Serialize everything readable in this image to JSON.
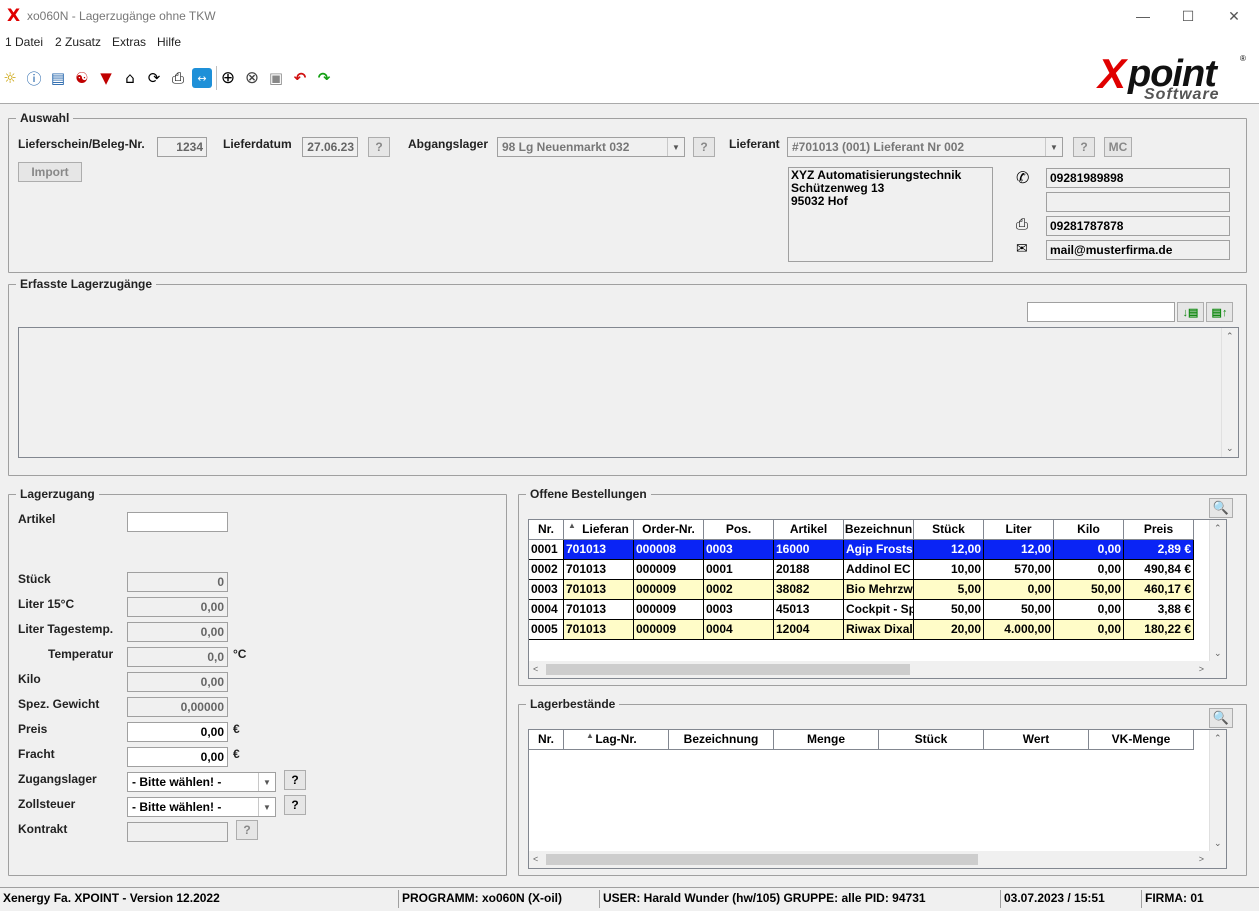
{
  "window": {
    "title": "xo060N - Lagerzugänge ohne TKW",
    "app_icon": "X"
  },
  "menu": [
    "1 Datei",
    "2 Zusatz",
    "Extras",
    "Hilfe"
  ],
  "toolbar_icons": [
    "lightbulb-icon",
    "info-icon",
    "book-icon",
    "database-icon",
    "filter-icon",
    "home-icon",
    "refresh-icon",
    "print-icon",
    "teamviewer-icon",
    "add-icon",
    "cancel-icon",
    "save-icon",
    "undo-icon",
    "redo-icon"
  ],
  "logo": {
    "text": "point",
    "x": "X",
    "sub": "Software",
    "reg": "®"
  },
  "auswahl": {
    "legend": "Auswahl",
    "beleg_label": "Lieferschein/Beleg-Nr.",
    "beleg_value": "1234",
    "datum_label": "Lieferdatum",
    "datum_value": "27.06.23",
    "q": "?",
    "lager_label": "Abgangslager",
    "lager_value": "98  Lg Neuenmarkt  032",
    "lieferant_label": "Lieferant",
    "lieferant_value": "#701013 (001) Lieferant Nr 002",
    "mc": "MC",
    "import": "Import",
    "address": [
      "XYZ Automatisierungstechnik",
      "Schützenweg 13",
      "95032 Hof"
    ],
    "phone": "09281989898",
    "phone2": "",
    "fax": "09281787878",
    "email": "mail@musterfirma.de"
  },
  "erfasste": {
    "legend": "Erfasste Lagerzugänge",
    "search": ""
  },
  "lagerzugang": {
    "legend": "Lagerzugang",
    "fields": [
      {
        "label": "Artikel",
        "value": ""
      },
      {
        "label": "Stück",
        "value": "0"
      },
      {
        "label": "Liter 15°C",
        "value": "0,00"
      },
      {
        "label": "Liter Tagestemp.",
        "value": "0,00"
      },
      {
        "label": "Temperatur",
        "value": "0,0",
        "unit": "°C"
      },
      {
        "label": "Kilo",
        "value": "0,00"
      },
      {
        "label": "Spez. Gewicht",
        "value": "0,00000"
      },
      {
        "label": "Preis",
        "value": "0,00",
        "unit": "€"
      },
      {
        "label": "Fracht",
        "value": "0,00",
        "unit": "€"
      }
    ],
    "zugangslager_label": "Zugangslager",
    "zugangslager_value": "- Bitte wählen! -",
    "zollsteuer_label": "Zollsteuer",
    "zollsteuer_value": "- Bitte wählen! -",
    "kontrakt_label": "Kontrakt",
    "kontrakt_value": ""
  },
  "offene": {
    "legend": "Offene Bestellungen",
    "columns": [
      "Nr.",
      "Lieferan",
      "Order-Nr.",
      "Pos.",
      "Artikel",
      "Bezeichnun",
      "Stück",
      "Liter",
      "Kilo",
      "Preis"
    ],
    "rows": [
      [
        "0001",
        "701013",
        "000008",
        "0003",
        "16000",
        "Agip Frostso",
        "12,00",
        "12,00",
        "0,00",
        "2,89 €"
      ],
      [
        "0002",
        "701013",
        "000009",
        "0001",
        "20188",
        "Addinol EC",
        "10,00",
        "570,00",
        "0,00",
        "490,84 €"
      ],
      [
        "0003",
        "701013",
        "000009",
        "0002",
        "38082",
        "Bio Mehrzw",
        "5,00",
        "0,00",
        "50,00",
        "460,17 €"
      ],
      [
        "0004",
        "701013",
        "000009",
        "0003",
        "45013",
        "Cockpit - Sp",
        "50,00",
        "50,00",
        "0,00",
        "3,88 €"
      ],
      [
        "0005",
        "701013",
        "000009",
        "0004",
        "12004",
        "Riwax Dixal",
        "20,00",
        "4.000,00",
        "0,00",
        "180,22 €"
      ]
    ],
    "row_styles": [
      "selected",
      "white",
      "yellow",
      "white",
      "yellow"
    ]
  },
  "bestaende": {
    "legend": "Lagerbestände",
    "columns": [
      "Nr.",
      "Lag-Nr.",
      "Bezeichnung",
      "Menge",
      "Stück",
      "Wert",
      "VK-Menge"
    ]
  },
  "status": {
    "version": "Xenergy Fa. XPOINT  - Version 12.2022",
    "programm": "PROGRAMM: xo060N (X-oil)",
    "user": "USER: Harald Wunder (hw/105)  GRUPPE: alle  PID: 94731",
    "datetime": "03.07.2023 / 15:51",
    "firma": "FIRMA: 01"
  },
  "colors": {
    "selected": "#0a24f5",
    "yellow": "#fffcc8",
    "accent_red": "#e00000"
  }
}
